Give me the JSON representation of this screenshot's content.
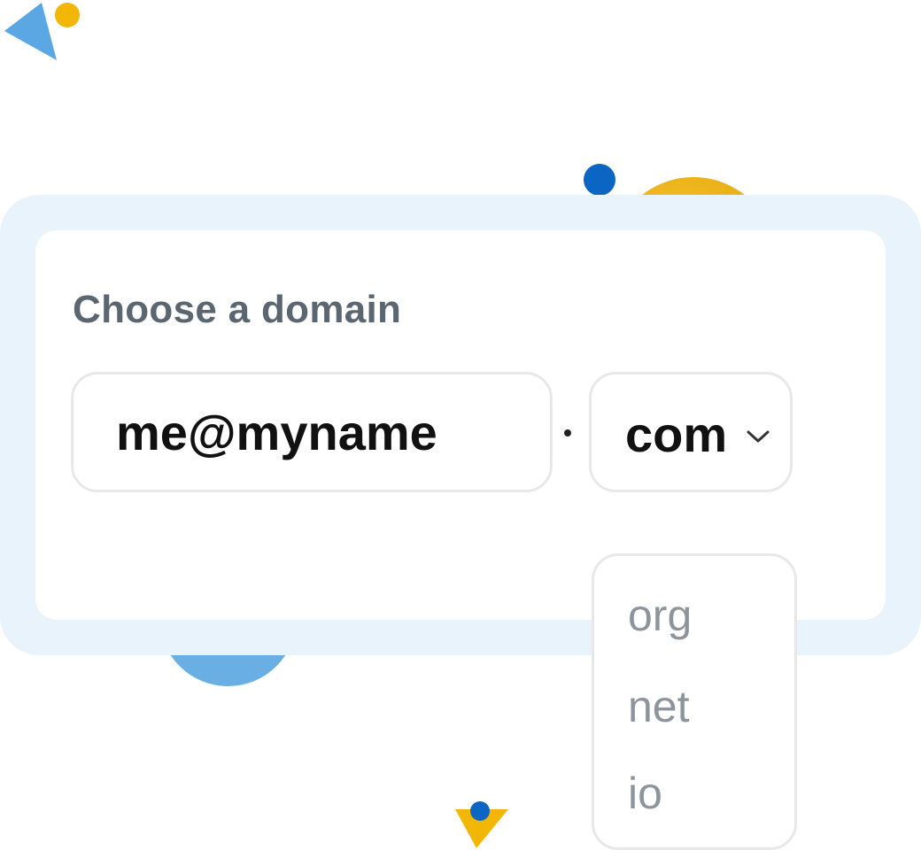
{
  "form": {
    "title": "Choose a domain",
    "name_input_value": "me@myname",
    "separator": "."
  },
  "tld_select": {
    "selected": "com",
    "icon": "chevron-down-icon"
  },
  "dropdown": {
    "options": [
      "org",
      "net",
      "io"
    ]
  },
  "colors": {
    "frame_bg": "#e8f3fb",
    "title_text": "#5c6670",
    "option_text": "#8c949c",
    "accent_blue": "#0a66c2",
    "accent_light_blue": "#6aafe3",
    "accent_yellow": "#f2b705"
  }
}
